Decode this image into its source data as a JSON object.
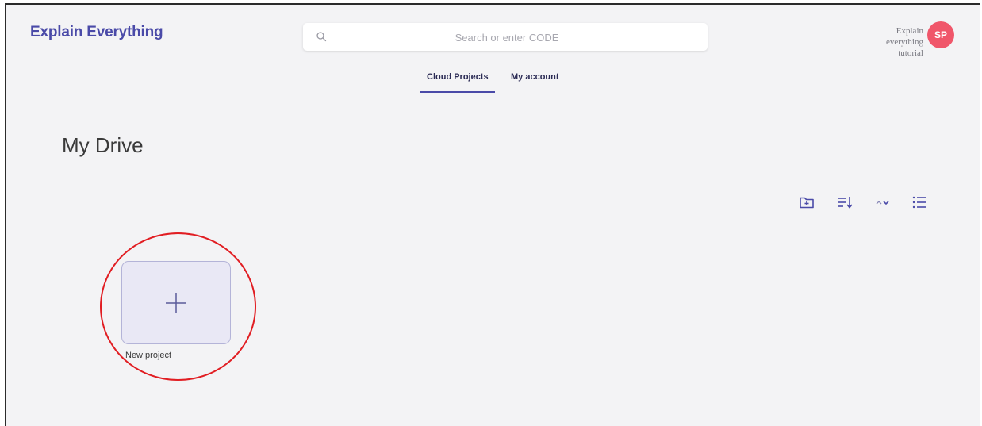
{
  "header": {
    "logo_text": "Explain Everything",
    "search_placeholder": "Search or enter CODE",
    "user_name_lines": [
      "Explain",
      "everything",
      "tutorial"
    ],
    "avatar_initials": "SP",
    "search_icon": "search-icon"
  },
  "tabs": [
    {
      "label": "Cloud Projects",
      "active": true
    },
    {
      "label": "My account",
      "active": false
    }
  ],
  "main": {
    "page_title": "My Drive",
    "toolbar_icons": [
      "new-folder-icon",
      "sort-icon",
      "sort-order-icon",
      "list-view-icon"
    ],
    "new_project_label": "New project",
    "new_project_icon": "plus-icon"
  },
  "colors": {
    "brand": "#4a4aa8",
    "avatar": "#f0566a",
    "card_bg": "#e9e8f5",
    "highlight": "#e11d22",
    "page_bg": "#f3f3f5"
  }
}
